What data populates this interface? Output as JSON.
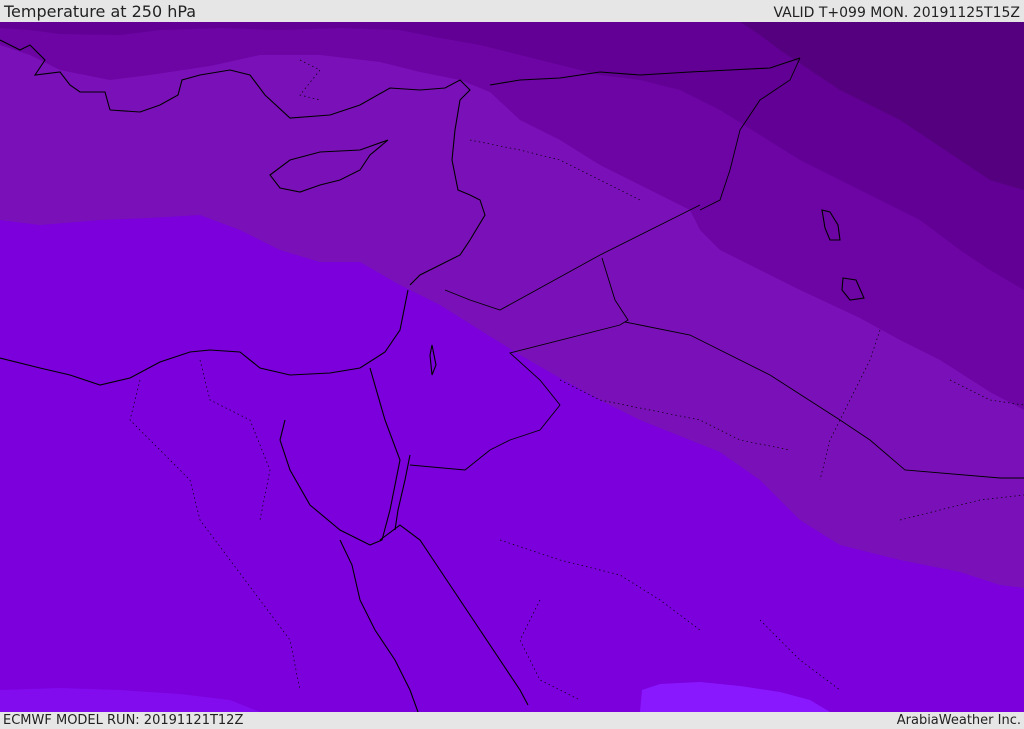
{
  "header": {
    "title": "Temperature at 250 hPa",
    "valid_time": "VALID T+099 MON. 20191125T15Z"
  },
  "footer": {
    "model_run": "ECMWF MODEL RUN: 20191121T12Z",
    "credit": "ArabiaWeather Inc."
  },
  "map": {
    "colors": {
      "band_warm": "#7b00dc",
      "band_mid": "#7a11b8",
      "band_cool": "#6c05a4",
      "band_cold": "#620095",
      "band_coldest": "#54007f",
      "band_hot_patch": "#8a18ff",
      "coastline": "#000000"
    }
  }
}
